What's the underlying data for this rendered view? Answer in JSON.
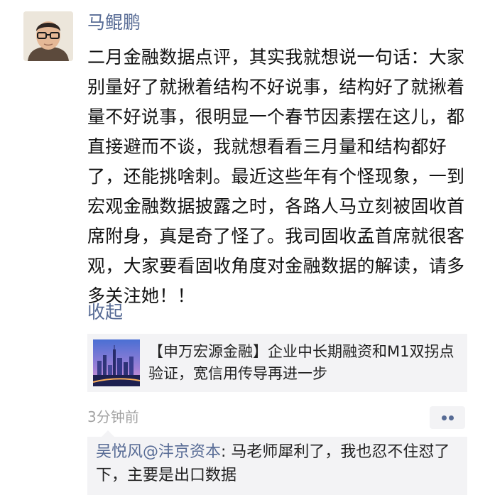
{
  "post": {
    "author": "马鲲鹏",
    "text": "二月金融数据点评，其实我就想说一句话：大家别量好了就揪着结构不好说事，结构好了就揪着量不好说事，很明显一个春节因素摆在这儿，都直接避而不谈，我就想看看三月量和结构都好了，还能挑啥刺。最近这些年有个怪现象，一到宏观金融数据披露之时，各路人马立刻被固收首席附身，真是奇了怪了。我司固收孟首席就很客观，大家要看固收角度对金融数据的解读，请多多关注她！！",
    "collapse_label": "收起",
    "timestamp": "3分钟前"
  },
  "link_card": {
    "title": "【申万宏源金融】企业中长期融资和M1双拐点验证，宽信用传导再进一步",
    "thumbnail_icon": "city-skyline-image"
  },
  "comments": [
    {
      "author": "吴悦风@沣京资本",
      "separator": ": ",
      "text": "马老师犀利了，我也忍不住怼了下，主要是出口数据"
    }
  ],
  "colors": {
    "name_link": "#576b95",
    "card_background": "#f3f3f5",
    "timestamp": "#a3a3a3",
    "text": "#111111"
  }
}
